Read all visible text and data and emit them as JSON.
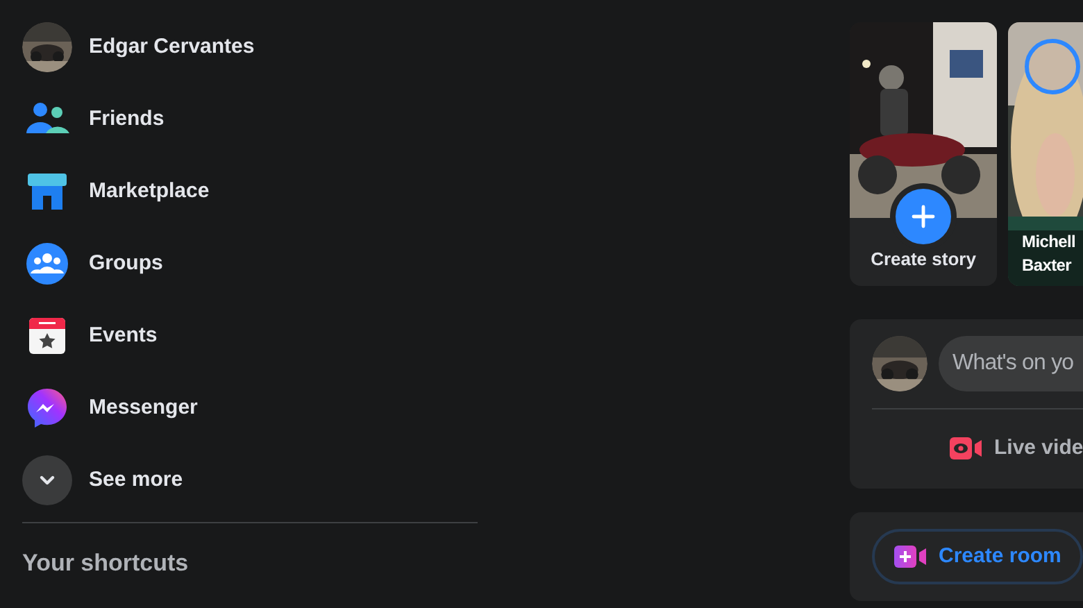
{
  "sidebar": {
    "profile": {
      "name": "Edgar Cervantes"
    },
    "items": [
      {
        "kind": "friends",
        "label": "Friends"
      },
      {
        "kind": "marketplace",
        "label": "Marketplace"
      },
      {
        "kind": "groups",
        "label": "Groups"
      },
      {
        "kind": "events",
        "label": "Events"
      },
      {
        "kind": "messenger",
        "label": "Messenger"
      },
      {
        "kind": "more",
        "label": "See more"
      }
    ],
    "shortcuts_heading": "Your shortcuts"
  },
  "stories": [
    {
      "kind": "create",
      "label": "Create story"
    },
    {
      "kind": "friend",
      "label": "Michell\nBaxter"
    }
  ],
  "composer": {
    "placeholder": "What's on yo",
    "action": "Live vide"
  },
  "room": {
    "label": "Create room"
  }
}
